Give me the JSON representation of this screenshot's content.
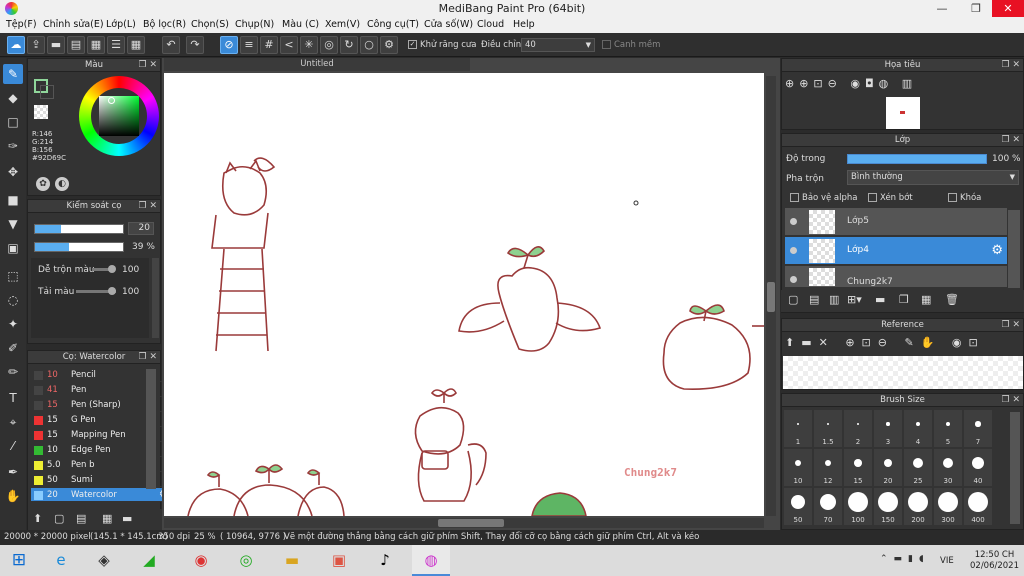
{
  "window": {
    "title": "MediBang Paint Pro (64bit)",
    "minimize": "—",
    "maximize": "❐",
    "close": "✕"
  },
  "menu": [
    "Tệp(F)",
    "Chỉnh sửa(E)",
    "Lớp(L)",
    "Bộ lọc(R)",
    "Chọn(S)",
    "Chụp(N)",
    "Màu (C)",
    "Xem(V)",
    "Công cụ(T)",
    "Cửa số(W)",
    "Cloud",
    "Help"
  ],
  "toolbar": {
    "antialias": "Khử răng cưa",
    "adjust_label": "Điều chỉnh",
    "adjust_value": "40",
    "smooth": "Canh mềm"
  },
  "color_panel": {
    "title": "Màu",
    "r": "R:146",
    "g": "G:214",
    "b": "B:156",
    "hex": "#92D69C",
    "fg": "#c0392b",
    "bg": "#ffffff"
  },
  "brush_ctrl": {
    "title": "Kiểm soát cọ",
    "size": "20",
    "size_fill": 0.3,
    "opacity": "39 %",
    "opacity_fill": 0.39,
    "blend_label": "Dễ trộn màu",
    "blend_value": "100",
    "amount_label": "Tải màu",
    "amount_value": "100"
  },
  "brush_list": {
    "title": "Cọ: Watercolor",
    "items": [
      {
        "n": "10",
        "label": "Pencil",
        "color": "#444"
      },
      {
        "n": "41",
        "label": "Pen",
        "color": "#444"
      },
      {
        "n": "15",
        "label": "Pen (Sharp)",
        "color": "#444"
      },
      {
        "n": "15",
        "label": "G Pen",
        "color": "#e33"
      },
      {
        "n": "15",
        "label": "Mapping Pen",
        "color": "#e33"
      },
      {
        "n": "10",
        "label": "Edge Pen",
        "color": "#3b3"
      },
      {
        "n": "5.0",
        "label": "Pen b",
        "color": "#ee3"
      },
      {
        "n": "50",
        "label": "Sumi",
        "color": "#ee3"
      },
      {
        "n": "20",
        "label": "Watercolor",
        "color": "#8cf"
      }
    ]
  },
  "canvas": {
    "tab": "Untitled",
    "signature": "Chung2k7"
  },
  "navigator": {
    "title": "Họa tiêu"
  },
  "layers": {
    "title": "Lớp",
    "opacity_label": "Độ trong",
    "opacity_value": "100 %",
    "opacity_fill": 1.0,
    "blend_label": "Pha trộn",
    "blend_value": "Bình thường",
    "protect": "Bảo vệ alpha",
    "clip": "Xén bớt",
    "lock": "Khóa",
    "items": [
      "Lớp5",
      "Lớp4",
      "Chung2k7"
    ]
  },
  "reference": {
    "title": "Reference"
  },
  "brush_size": {
    "title": "Brush Size",
    "sizes": [
      "1",
      "1.5",
      "2",
      "3",
      "4",
      "5",
      "7",
      "10",
      "12",
      "15",
      "20",
      "25",
      "30",
      "40",
      "50",
      "70",
      "100",
      "150",
      "200",
      "300",
      "400"
    ]
  },
  "status": {
    "dims": "20000 * 20000 pixel",
    "cm": "(145.1 * 145.1cm)",
    "dpi": "350 dpi",
    "zoom": "25 %",
    "coords": "( 10964, 9776 )",
    "hint": "Vẽ một đường thẳng bằng cách giữ phím Shift, Thay đổi cỡ cọ bằng cách giữ phím Ctrl, Alt và kéo"
  },
  "taskbar": {
    "lang": "VIE",
    "time": "12:50 CH",
    "date": "02/06/2021"
  }
}
